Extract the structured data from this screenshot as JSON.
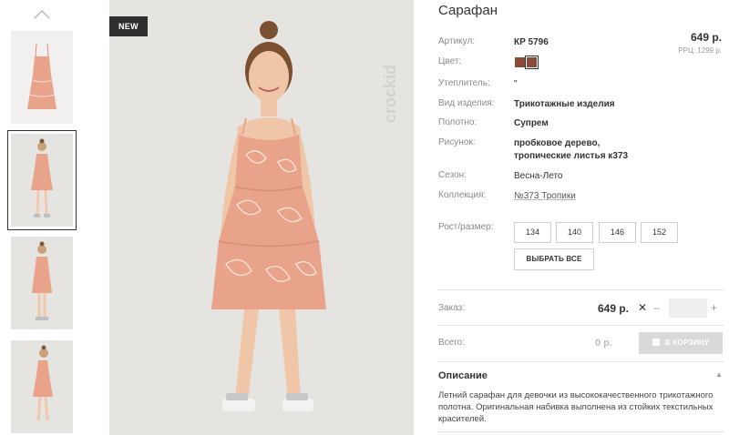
{
  "product": {
    "title": "Сарафан",
    "price": "649 р.",
    "rrp": "РРЦ: 1299 р.",
    "badge": "NEW",
    "brand": "crockid"
  },
  "specs": [
    {
      "label": "Артикул:",
      "value": "КР 5796"
    },
    {
      "label": "Цвет:",
      "value": ""
    },
    {
      "label": "Утеплитель:",
      "value": "\""
    },
    {
      "label": "Вид изделия:",
      "value": "Трикотажные изделия"
    },
    {
      "label": "Полотно:",
      "value": "Супрем"
    },
    {
      "label": "Рисунок:",
      "value": "пробковое дерево,\nтропические листья к373"
    },
    {
      "label": "Сезон:",
      "value": "Весна-Лето"
    },
    {
      "label": "Коллекция:",
      "value": "№373 Тропики"
    }
  ],
  "colors": [
    "#8a4a3a",
    "#8a4a3a"
  ],
  "sizes": {
    "label": "Рост/размер:",
    "options": [
      "134",
      "140",
      "146",
      "152"
    ],
    "select_all": "ВЫБРАТЬ ВСЕ"
  },
  "order": {
    "label": "Заказ:",
    "price": "649 р.",
    "remove": "✕",
    "minus": "–",
    "plus": "+",
    "quantity": ""
  },
  "total": {
    "label": "Всего:",
    "value": "0 р.",
    "cart_button": "В КОРЗИНУ"
  },
  "description": {
    "title": "Описание",
    "caret": "▲",
    "text": "Летний сарафан для девочки из высококачественного трикотажного полотна. Оригинальная набивка выполнена из стойких текстильных красителей."
  },
  "theme": {
    "dress": "#e8a38a",
    "background": "#e6e4e1"
  }
}
